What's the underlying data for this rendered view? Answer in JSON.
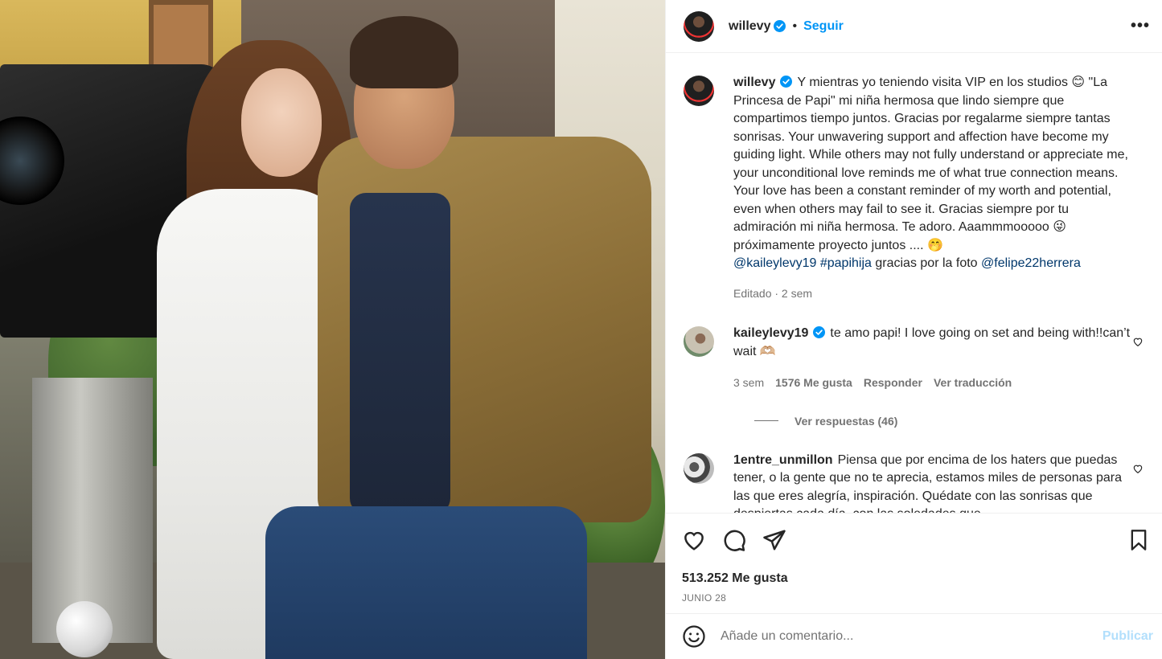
{
  "post": {
    "author": "willevy",
    "follow_label": "Seguir",
    "separator": "•",
    "more_icon": "more-horizontal-icon",
    "caption_parts": {
      "text": "Y mientras yo teniendo visita VIP en los studios 😊 \"La Princesa de Papi\" mi niña hermosa que lindo siempre que compartimos tiempo juntos. Gracias por regalarme siempre tantas sonrisas. Your unwavering support and affection have become my guiding light. While others may not fully understand or appreciate me, your unconditional love reminds me of what true connection means. Your love has been a constant reminder of my worth and potential, even when others may fail to see it. Gracias siempre por tu admiración mi niña hermosa. Te adoro. Aaammmooooo 😜 próximamente proyecto juntos .... 🤭",
      "mention1": "@kaileylevy19",
      "hashtag": "#papihija",
      "middle": "gracias por la foto",
      "mention2": "@felipe22herrera"
    },
    "caption_meta": "Editado · 2 sem",
    "likes": "513.252 Me gusta",
    "date": "JUNIO 28",
    "accent": "#0095f6"
  },
  "comments": [
    {
      "user": "kaileylevy19",
      "text": "te amo papi! I love going on set and being with!!can’t wait 🫶🏼",
      "time": "3 sem",
      "likes": "1576 Me gusta",
      "reply": "Responder",
      "translate": "Ver traducción",
      "replies": "Ver respuestas (46)"
    },
    {
      "user": "1entre_unmillon",
      "text": "Piensa que por encima de los haters que puedas tener, o la gente que no te aprecia, estamos miles de personas para las que eres alegría, inspiración. Quédate con las sonrisas que despiertas cada día, con las soledades que"
    }
  ],
  "add_comment": {
    "placeholder": "Añade un comentario...",
    "publish": "Publicar"
  }
}
